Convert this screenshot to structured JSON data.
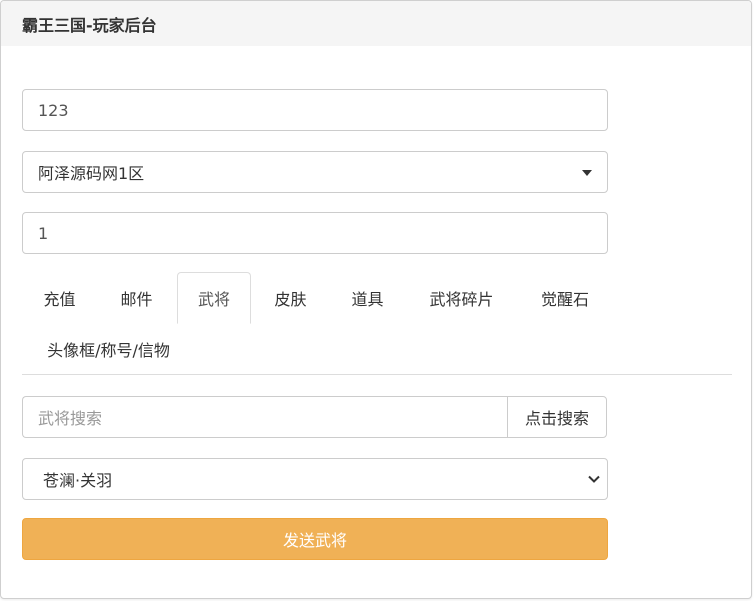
{
  "header": {
    "title": "霸王三国-玩家后台"
  },
  "form": {
    "account_value": "123",
    "server_select": "阿泽源码网1区",
    "quantity_value": "1"
  },
  "tabs": [
    {
      "label": "充值",
      "active": false
    },
    {
      "label": "邮件",
      "active": false
    },
    {
      "label": "武将",
      "active": true
    },
    {
      "label": "皮肤",
      "active": false
    },
    {
      "label": "道具",
      "active": false
    },
    {
      "label": "武将碎片",
      "active": false
    },
    {
      "label": "觉醒石",
      "active": false
    },
    {
      "label": "头像框/称号/信物",
      "active": false
    }
  ],
  "general_tab": {
    "search_placeholder": "武将搜索",
    "search_button": "点击搜索",
    "general_select": "苍澜·关羽",
    "send_button": "发送武将"
  },
  "icons": {
    "server_dropdown": "caret-down-icon",
    "general_dropdown": "chevron-down-icon"
  },
  "colors": {
    "send_button_bg": "#f0ad4e",
    "heading_bg": "#f5f5f5"
  }
}
